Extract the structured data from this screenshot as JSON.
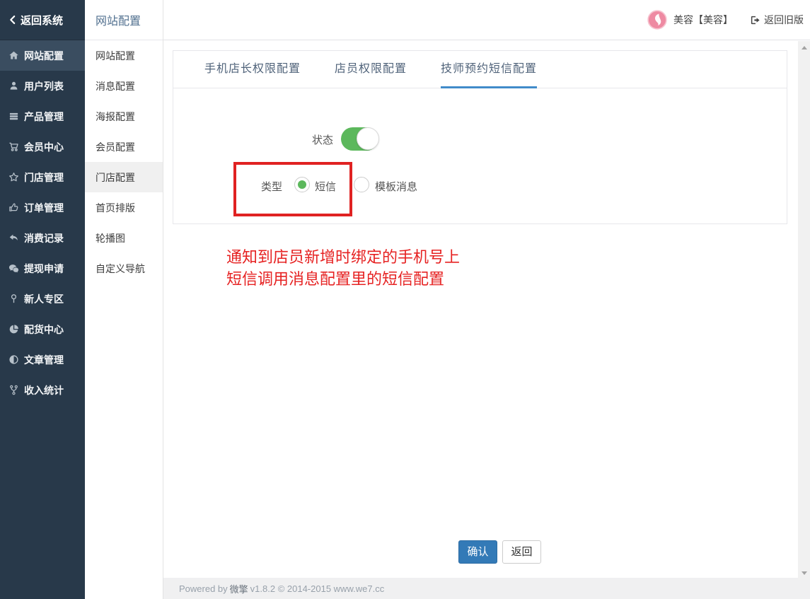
{
  "header": {
    "back_label": "返回系统",
    "module_title": "网站配置",
    "user_name": "美容【美容】",
    "old_version_label": "返回旧版"
  },
  "sidebar": {
    "items": [
      {
        "label": "网站配置",
        "icon": "home",
        "active": true
      },
      {
        "label": "用户列表",
        "icon": "user",
        "active": false
      },
      {
        "label": "产品管理",
        "icon": "list",
        "active": false
      },
      {
        "label": "会员中心",
        "icon": "cart",
        "active": false
      },
      {
        "label": "门店管理",
        "icon": "star",
        "active": false
      },
      {
        "label": "订单管理",
        "icon": "thumbs-up",
        "active": false
      },
      {
        "label": "消费记录",
        "icon": "reply-arrow",
        "active": false
      },
      {
        "label": "提现申请",
        "icon": "wechat",
        "active": false
      },
      {
        "label": "新人专区",
        "icon": "map-pin",
        "active": false
      },
      {
        "label": "配货中心",
        "icon": "pie-chart",
        "active": false
      },
      {
        "label": "文章管理",
        "icon": "adjust",
        "active": false
      },
      {
        "label": "收入统计",
        "icon": "code-fork",
        "active": false
      }
    ]
  },
  "submenu": {
    "items": [
      {
        "label": "网站配置",
        "active": false
      },
      {
        "label": "消息配置",
        "active": false
      },
      {
        "label": "海报配置",
        "active": false
      },
      {
        "label": "会员配置",
        "active": false
      },
      {
        "label": "门店配置",
        "active": true
      },
      {
        "label": "首页排版",
        "active": false
      },
      {
        "label": "轮播图",
        "active": false
      },
      {
        "label": "自定义导航",
        "active": false
      }
    ]
  },
  "main": {
    "tabs": [
      {
        "label": "手机店长权限配置",
        "active": false
      },
      {
        "label": "店员权限配置",
        "active": false
      },
      {
        "label": "技师预约短信配置",
        "active": true
      }
    ],
    "form": {
      "status_label": "状态",
      "status_on": true,
      "type_label": "类型",
      "type_options": [
        {
          "label": "短信",
          "selected": true
        },
        {
          "label": "模板消息",
          "selected": false
        }
      ]
    },
    "annotation": {
      "line1": "通知到店员新增时绑定的手机号上",
      "line2": "短信调用消息配置里的短信配置"
    },
    "buttons": {
      "confirm": "确认",
      "back": "返回"
    }
  },
  "footer": {
    "powered_prefix": "Powered by",
    "brand": "微擎",
    "suffix": "v1.8.2 © 2014-2015 www.we7.cc"
  },
  "colors": {
    "sidebar_bg": "#28394a",
    "sidebar_active_bg": "#3a4d60",
    "submenu_active_bg": "#f0f0f0",
    "tab_underline_blue": "#418bca",
    "toggle_green": "#5cb85c",
    "annotation_red": "#e02222",
    "confirm_blue": "#337ab7",
    "avatar_pink": "#ee8aa2"
  }
}
